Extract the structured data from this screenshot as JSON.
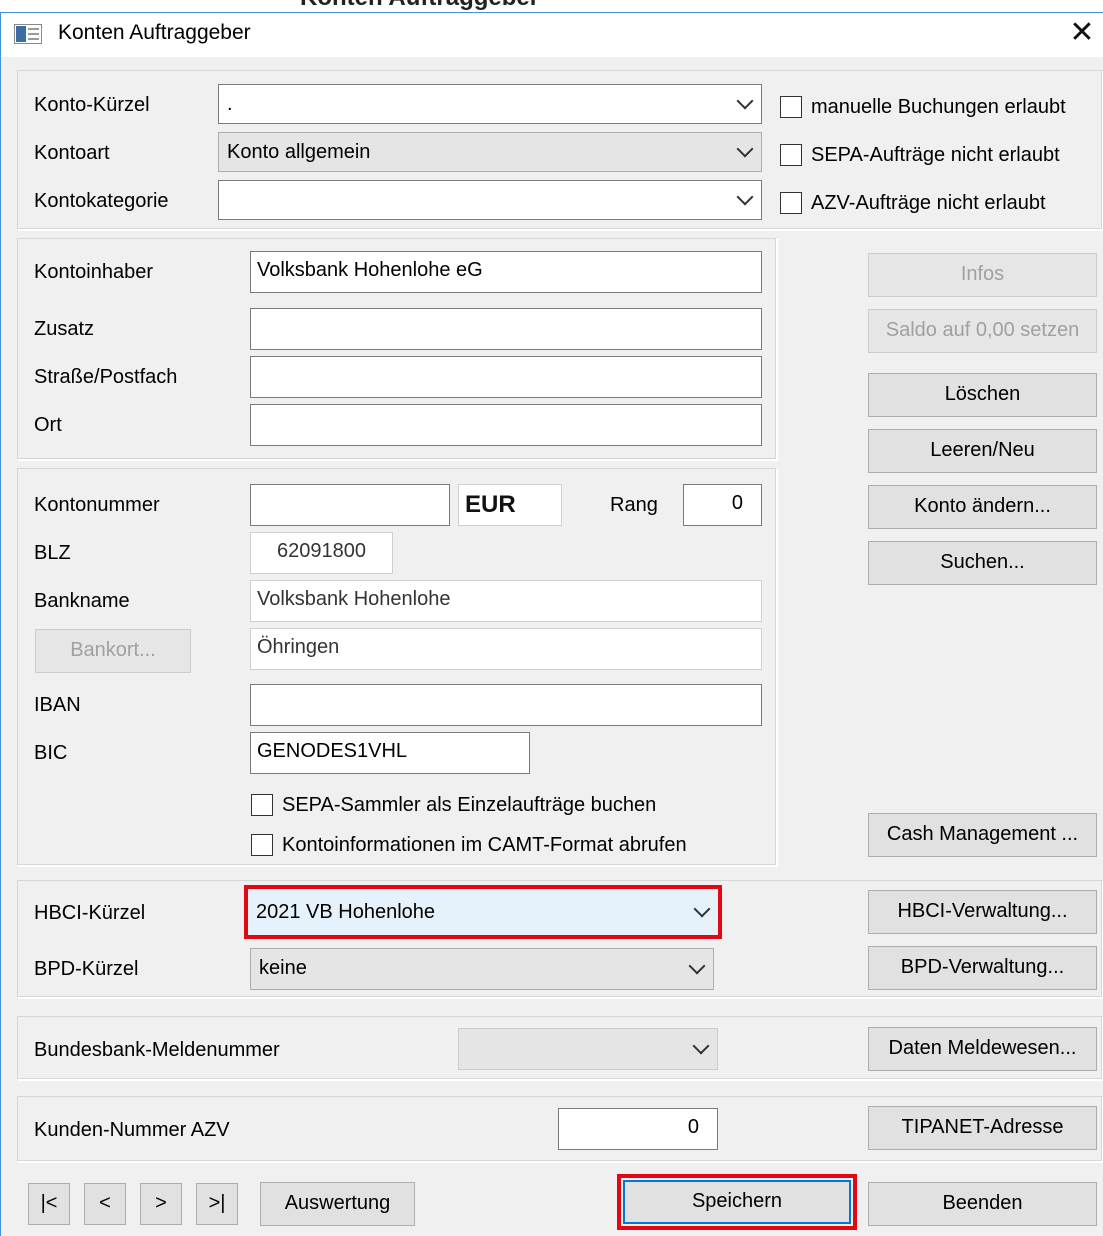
{
  "window": {
    "top_strip_text": "Konten Auftraggeber",
    "title": "Konten Auftraggeber",
    "close_glyph": "✕"
  },
  "account": {
    "kuerzel_label": "Konto-Kürzel",
    "kuerzel_value": ".",
    "kontoart_label": "Kontoart",
    "kontoart_value": "Konto allgemein",
    "kategorie_label": "Kontokategorie",
    "kategorie_value": ""
  },
  "flags": {
    "manual_bookings": "manuelle Buchungen erlaubt",
    "sepa_not_allowed": "SEPA-Aufträge nicht erlaubt",
    "azv_not_allowed": "AZV-Aufträge nicht erlaubt"
  },
  "holder": {
    "owner_label": "Kontoinhaber",
    "owner_value": "Volksbank Hohenlohe eG",
    "zusatz_label": "Zusatz",
    "zusatz_value": "",
    "street_label": "Straße/Postfach",
    "street_value": "",
    "city_label": "Ort",
    "city_value": ""
  },
  "bank": {
    "number_label": "Kontonummer",
    "number_value": "",
    "currency": "EUR",
    "rank_label": "Rang",
    "rank_value": "0",
    "blz_label": "BLZ",
    "blz_value": "62091800",
    "bankname_label": "Bankname",
    "bankname_value": "Volksbank Hohenlohe",
    "bankort_button": "Bankort...",
    "bankort_value": "Öhringen",
    "iban_label": "IBAN",
    "iban_value": "",
    "bic_label": "BIC",
    "bic_value": "GENODES1VHL",
    "sepa_collector": "SEPA-Sammler als Einzelaufträge buchen",
    "camt_info": "Kontoinformationen im CAMT-Format abrufen"
  },
  "side_buttons": {
    "infos": "Infos",
    "saldo": "Saldo auf 0,00 setzen",
    "delete": "Löschen",
    "clear_new": "Leeren/Neu",
    "change_account": "Konto ändern...",
    "search": "Suchen...",
    "cash_management": "Cash Management ..."
  },
  "hbci": {
    "hbci_label": "HBCI-Kürzel",
    "hbci_value": "2021 VB Hohenlohe",
    "bpd_label": "BPD-Kürzel",
    "bpd_value": "keine",
    "hbci_admin": "HBCI-Verwaltung...",
    "bpd_admin": "BPD-Verwaltung..."
  },
  "bundesbank": {
    "label": "Bundesbank-Meldenummer",
    "value": "",
    "button": "Daten Meldewesen..."
  },
  "azv": {
    "label": "Kunden-Nummer AZV",
    "value": "0",
    "button": "TIPANET-Adresse"
  },
  "footer": {
    "first": "|<",
    "prev": "<",
    "next": ">",
    "last": ">|",
    "report": "Auswertung",
    "save": "Speichern",
    "exit": "Beenden"
  },
  "colors": {
    "highlight": "#e30613",
    "focus_border": "#0078d7",
    "face": "#f0f0f0"
  }
}
